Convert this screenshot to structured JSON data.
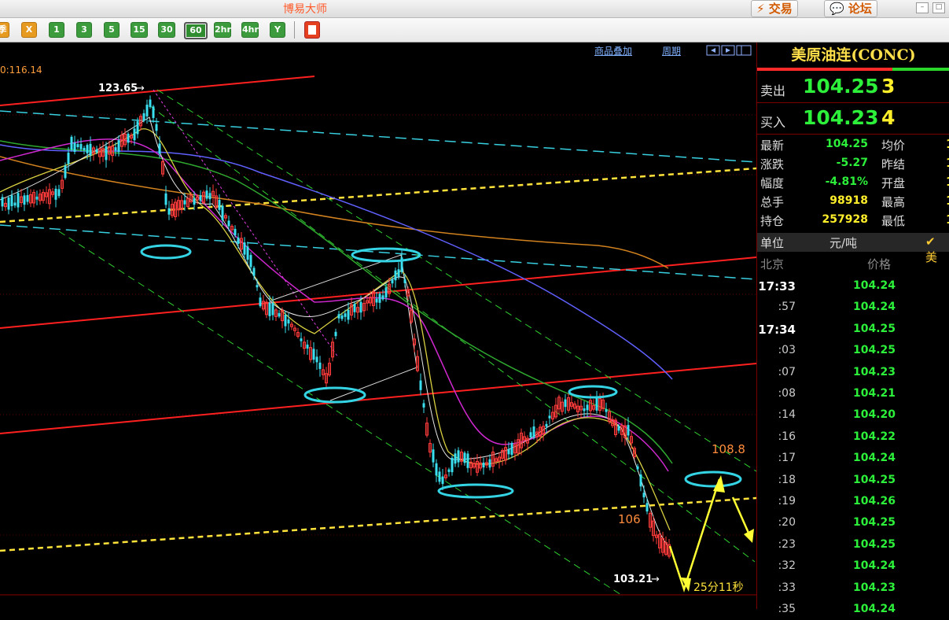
{
  "app": {
    "title": "博易大师"
  },
  "header": {
    "trade_label": "⚡ 交易",
    "forum_label": "💬 论坛"
  },
  "toolbar": {
    "items": [
      {
        "label": "季",
        "style": "orange"
      },
      {
        "label": "X",
        "style": "orange"
      },
      {
        "label": "1",
        "style": "green"
      },
      {
        "label": "3",
        "style": "green"
      },
      {
        "label": "5",
        "style": "green"
      },
      {
        "label": "15",
        "style": "green"
      },
      {
        "label": "30",
        "style": "green"
      },
      {
        "label": "60",
        "style": "selected"
      },
      {
        "label": "2hr",
        "style": "green"
      },
      {
        "label": "4hr",
        "style": "green"
      },
      {
        "label": "Y",
        "style": "green"
      }
    ],
    "extra_icon": "notebook-icon"
  },
  "chart": {
    "overlay_label": "商品叠加",
    "period_label": "周期",
    "ma_readout": "0:116.14",
    "high_label": "123.65",
    "low_label": "103.21",
    "target_label_high": "108.8",
    "target_label_low": "106",
    "countdown": "25分11秒"
  },
  "chart_data": {
    "type": "candlestick",
    "symbol": "美原油连",
    "timeframe": "60",
    "annotated_high": 123.65,
    "annotated_low": 103.21,
    "price_labels": [
      108.8,
      106
    ]
  },
  "panel": {
    "title": "美原油连(CONC)",
    "sell_label": "卖出",
    "sell_price": "104.25",
    "sell_vol": "3",
    "buy_label": "买入",
    "buy_price": "104.23",
    "buy_vol": "4",
    "stats": [
      {
        "l1": "最新",
        "v1": "104.25",
        "c1": "#2cf03a",
        "l2": "均价",
        "v2": "1"
      },
      {
        "l1": "涨跌",
        "v1": "-5.27",
        "c1": "#2cf03a",
        "l2": "昨结",
        "v2": "1"
      },
      {
        "l1": "幅度",
        "v1": "-4.81%",
        "c1": "#2cf03a",
        "l2": "开盘",
        "v2": "1"
      },
      {
        "l1": "总手",
        "v1": "98918",
        "c1": "#ffef2a",
        "l2": "最高",
        "v2": "1"
      },
      {
        "l1": "持仓",
        "v1": "257928",
        "c1": "#ffef2a",
        "l2": "最低",
        "v2": "1"
      }
    ],
    "unit_label": "单位",
    "unit_value": "元/吨",
    "unit_check": "✔ 美",
    "tick_head_time": "北京",
    "tick_head_price": "价格",
    "ticks": [
      {
        "time": "17:33",
        "price": "104.24",
        "bold": true
      },
      {
        "time": ":57",
        "price": "104.24"
      },
      {
        "time": "17:34",
        "price": "104.25",
        "bold": true
      },
      {
        "time": ":03",
        "price": "104.25"
      },
      {
        "time": ":07",
        "price": "104.23"
      },
      {
        "time": ":08",
        "price": "104.21"
      },
      {
        "time": ":14",
        "price": "104.20"
      },
      {
        "time": ":16",
        "price": "104.22"
      },
      {
        "time": ":17",
        "price": "104.24"
      },
      {
        "time": ":18",
        "price": "104.25"
      },
      {
        "time": ":19",
        "price": "104.26"
      },
      {
        "time": ":20",
        "price": "104.25"
      },
      {
        "time": ":23",
        "price": "104.25"
      },
      {
        "time": ":32",
        "price": "104.24"
      },
      {
        "time": ":33",
        "price": "104.23"
      },
      {
        "time": ":35",
        "price": "104.24"
      }
    ]
  }
}
